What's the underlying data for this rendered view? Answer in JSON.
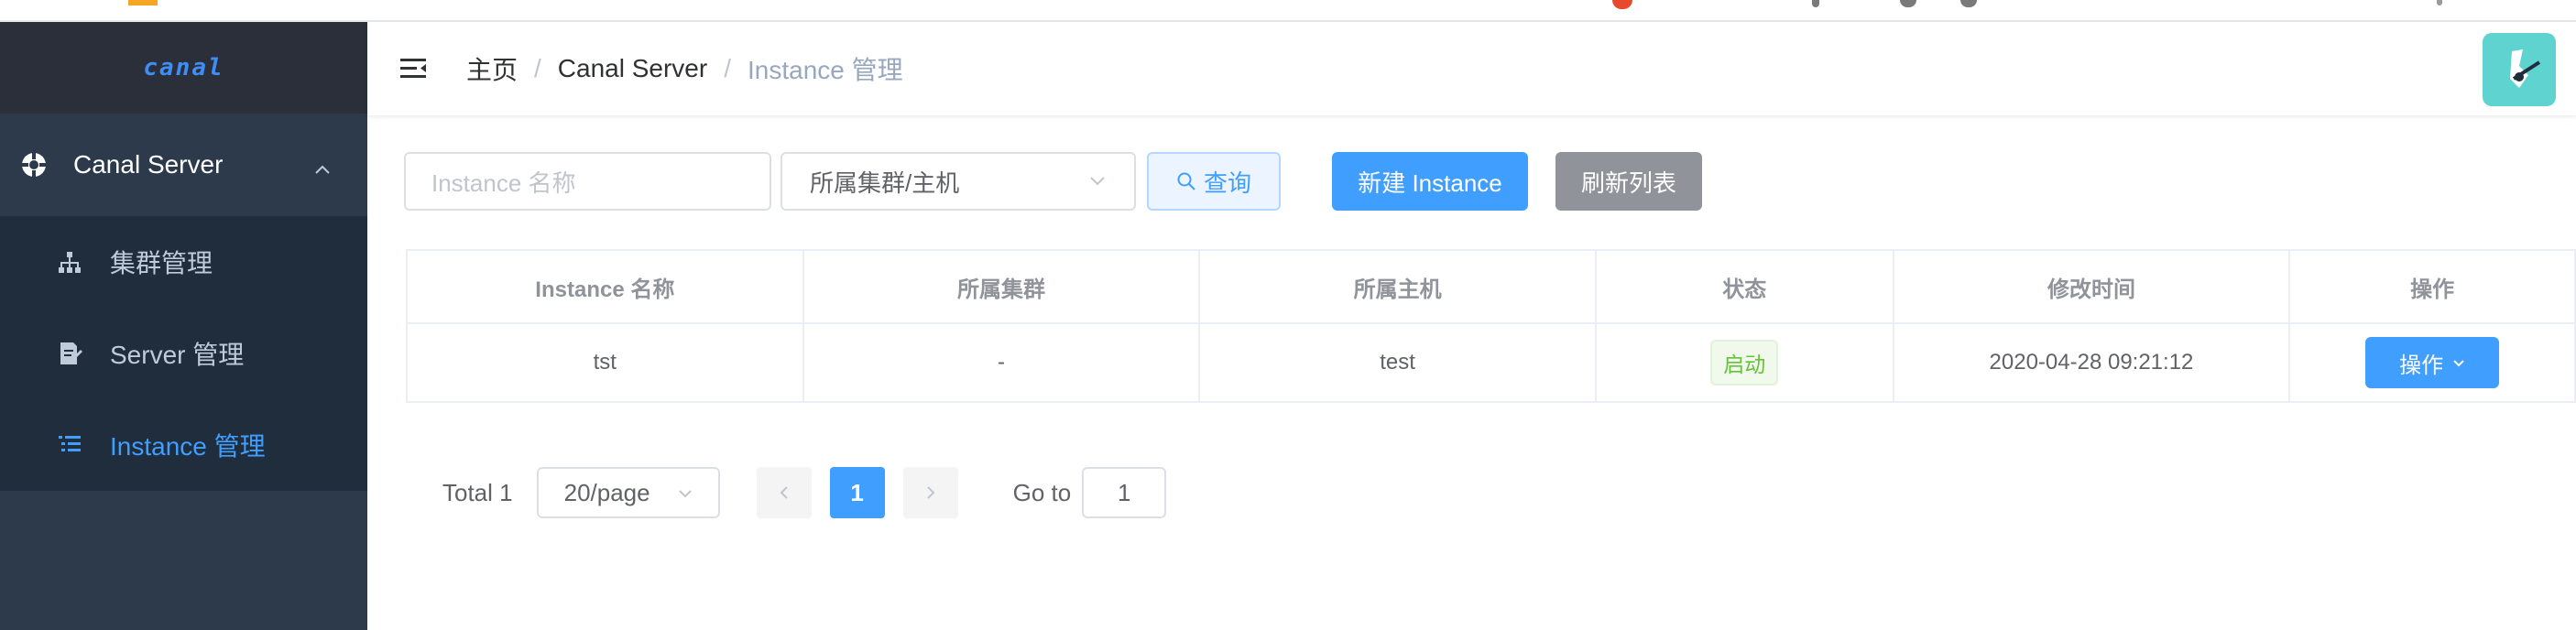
{
  "sidebar": {
    "logo": "canal",
    "menu_head": {
      "label": "Canal Server",
      "icon": "compass-icon"
    },
    "items": [
      {
        "label": "集群管理",
        "icon": "sitemap-icon",
        "active": false
      },
      {
        "label": "Server 管理",
        "icon": "edit-document-icon",
        "active": false
      },
      {
        "label": "Instance 管理",
        "icon": "list-icon",
        "active": true
      }
    ]
  },
  "header": {
    "breadcrumb": [
      "主页",
      "Canal Server",
      "Instance 管理"
    ],
    "separator": "/"
  },
  "filters": {
    "name_placeholder": "Instance 名称",
    "cluster_select": "所属集群/主机",
    "query_label": "查询",
    "new_label": "新建 Instance",
    "refresh_label": "刷新列表"
  },
  "table": {
    "columns": [
      "Instance 名称",
      "所属集群",
      "所属主机",
      "状态",
      "修改时间",
      "操作"
    ],
    "rows": [
      {
        "name": "tst",
        "cluster": "-",
        "host": "test",
        "status": "启动",
        "modified": "2020-04-28 09:21:12",
        "action": "操作"
      }
    ]
  },
  "pagination": {
    "total": "Total 1",
    "page_size": "20/page",
    "current_page": "1",
    "goto_label": "Go to",
    "goto_value": "1"
  },
  "colors": {
    "primary": "#409eff",
    "sidebar_bg": "#2d3a4b",
    "submenu_bg": "#1f2d3d",
    "success": "#67c23a",
    "info": "#909399"
  }
}
